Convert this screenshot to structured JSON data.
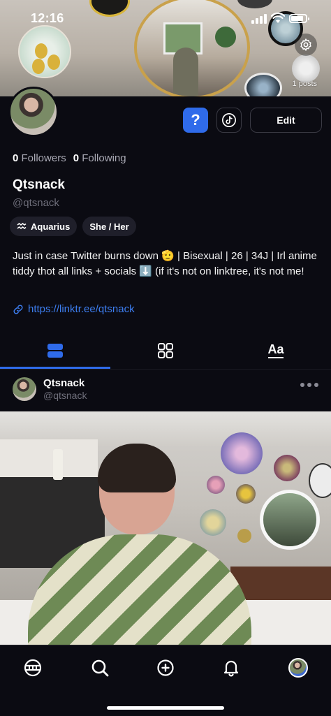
{
  "status_bar": {
    "time": "12:16",
    "battery_level": 0.85
  },
  "header": {
    "posts_count": "1 posts"
  },
  "profile": {
    "followers_count": "0",
    "followers_label": "Followers",
    "following_count": "0",
    "following_label": "Following",
    "display_name": "Qtsnack",
    "handle": "@qtsnack",
    "zodiac_label": "Aquarius",
    "pronouns_label": "She / Her",
    "bio": "Just in case Twitter burns down 🫡  | Bisexual | 26 | 34J | Irl anime tiddy thot all links + socials ⬇️  (if it's not on linktree, it's not me!",
    "link": "https://linktr.ee/qtsnack"
  },
  "actions": {
    "question_label": "?",
    "edit_label": "Edit"
  },
  "tabs": {
    "items": [
      {
        "icon": "feed-list-icon",
        "active": true
      },
      {
        "icon": "grid-icon",
        "active": false
      },
      {
        "icon": "text-posts-icon",
        "active": false
      }
    ],
    "text_tab_label": "Aa"
  },
  "post": {
    "author_name": "Qtsnack",
    "author_handle": "@qtsnack"
  },
  "bottom_nav": {
    "items": [
      "home-icon",
      "search-icon",
      "create-post-icon",
      "notifications-icon",
      "profile-avatar"
    ]
  },
  "colors": {
    "accent": "#2f6bea",
    "link": "#3d7ef0",
    "background": "#0b0b12"
  }
}
